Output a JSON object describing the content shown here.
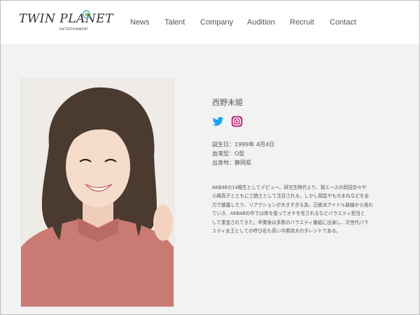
{
  "brand": {
    "logo_main": "TWIN PLANET",
    "logo_sub": "ENTERTAINMENT",
    "accent_color": "#4db8c8"
  },
  "nav": {
    "items": [
      {
        "label": "News"
      },
      {
        "label": "Talent"
      },
      {
        "label": "Company"
      },
      {
        "label": "Audition"
      },
      {
        "label": "Recruit"
      },
      {
        "label": "Contact"
      }
    ]
  },
  "profile": {
    "name": "西野未姫",
    "social": [
      {
        "icon": "twitter-icon",
        "color": "#1da1f2"
      },
      {
        "icon": "instagram-icon",
        "color": "#c13584"
      }
    ],
    "birthday": "誕生日：1999年 4月4日",
    "blood_type": "血液型：O型",
    "birthplace": "出身地：静岡県",
    "bio_lines": [
      "AKB48の14期生としてデビュー。研究生時代より、現エースの岡田奈々や",
      "小嶋真子とともに三銃士として注目される。しかし顔芸やものまねなどを全",
      "力で披露したり、リアクションが大きすぎる為、正統派アイドル路線から逸れ",
      "ていき、AKB48の中では体を張ってオチを任されるなどバラエティ担当と",
      "して重宝されてきた。卒業後は多数のバラエティ番組に出演し、次世代バラ",
      "エティ女王としての呼び名も高い今期待大のタレントである。"
    ]
  }
}
